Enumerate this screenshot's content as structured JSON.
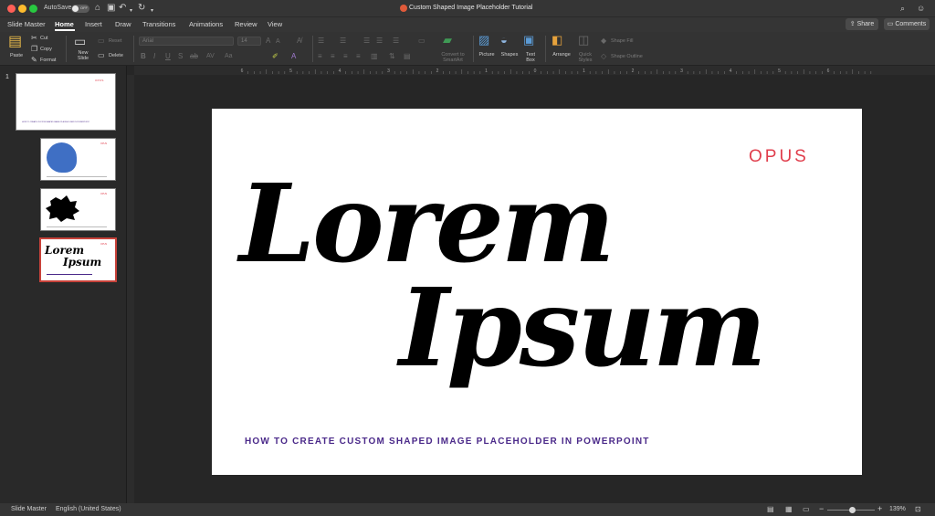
{
  "window": {
    "title": "Custom Shaped Image Placeholder Tutorial",
    "autosave_label": "AutoSave",
    "autosave_state": "OFF"
  },
  "tabs": [
    {
      "label": "Slide Master"
    },
    {
      "label": "Home"
    },
    {
      "label": "Insert"
    },
    {
      "label": "Draw"
    },
    {
      "label": "Transitions"
    },
    {
      "label": "Animations"
    },
    {
      "label": "Review"
    },
    {
      "label": "View"
    }
  ],
  "actions": {
    "share": "Share",
    "comments": "Comments"
  },
  "ribbon": {
    "paste": "Paste",
    "cut": "Cut",
    "copy": "Copy",
    "format": "Format",
    "new_slide": "New\nSlide",
    "reset": "Reset",
    "delete": "Delete",
    "font": "Arial",
    "font_size": "14",
    "convert": "Convert to\nSmartArt",
    "picture": "Picture",
    "shapes": "Shapes",
    "text_box": "Text\nBox",
    "arrange": "Arrange",
    "quick_styles": "Quick\nStyles",
    "shape_fill": "Shape Fill",
    "shape_outline": "Shape Outline"
  },
  "ruler": {
    "numbers": [
      "6",
      "5",
      "4",
      "3",
      "2",
      "1",
      "0",
      "1",
      "2",
      "3",
      "4",
      "5",
      "6"
    ]
  },
  "thumbnails": [
    {
      "number": "1",
      "caption": "HOW TO CREATE CUSTOM SHAPED IMAGE PLACEHOLDER IN POWERPOINT",
      "logo": "OPUS"
    },
    {
      "number": "",
      "logo": "OPUS"
    },
    {
      "number": "",
      "logo": "OPUS"
    },
    {
      "number": "",
      "logo": "OPUS",
      "title_line1": "Lorem",
      "title_line2": "Ipsum"
    }
  ],
  "slide": {
    "logo": "OPUS",
    "title_line1": "Lorem",
    "title_line2": "Ipsum",
    "subtitle": "HOW TO CREATE CUSTOM SHAPED IMAGE PLACEHOLDER IN POWERPOINT"
  },
  "status": {
    "view": "Slide Master",
    "language": "English (United States)",
    "zoom": "139%"
  },
  "colors": {
    "logo": "#e03e4c",
    "subtitle": "#4b2a8a",
    "selection": "#c8423a",
    "thumb_blob_blue": "#3f6fc4"
  }
}
